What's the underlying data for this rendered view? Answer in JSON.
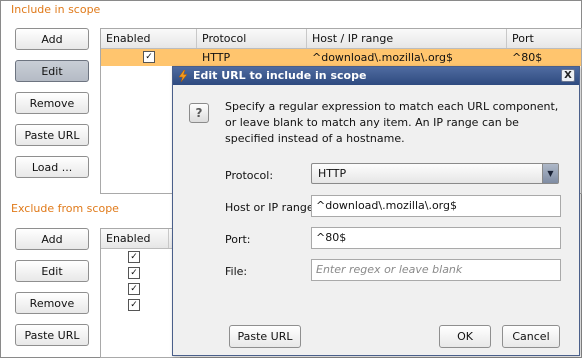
{
  "include_scope": {
    "title": "Include in scope",
    "buttons": {
      "add": "Add",
      "edit": "Edit",
      "remove": "Remove",
      "paste_url": "Paste URL",
      "load": "Load ..."
    },
    "columns": [
      "Enabled",
      "Protocol",
      "Host / IP range",
      "Port"
    ],
    "rows": [
      {
        "enabled": true,
        "protocol": "HTTP",
        "host": "^download\\.mozilla\\.org$",
        "port": "^80$",
        "selected": true
      }
    ]
  },
  "exclude_scope": {
    "title": "Exclude from scope",
    "buttons": {
      "add": "Add",
      "edit": "Edit",
      "remove": "Remove",
      "paste_url": "Paste URL"
    },
    "columns": [
      "Enabled"
    ],
    "rows_enabled": [
      true,
      true,
      true,
      true
    ]
  },
  "dialog": {
    "title": "Edit URL to include in scope",
    "description": "Specify a regular expression to match each URL component, or leave blank to match any item. An IP range can be specified instead of a hostname.",
    "protocol_label": "Protocol:",
    "protocol_value": "HTTP",
    "host_label": "Host or IP range:",
    "host_value": "^download\\.mozilla\\.org$",
    "port_label": "Port:",
    "port_value": "^80$",
    "file_label": "File:",
    "file_placeholder": "Enter regex or leave blank",
    "paste_url": "Paste URL",
    "ok": "OK",
    "cancel": "Cancel",
    "close_glyph": "X",
    "help_glyph": "?"
  },
  "colors": {
    "section_title": "#e07a1a",
    "selected_row": "#ffc56e",
    "titlebar": "#2e4a7f"
  },
  "checkbox_glyph": "✓"
}
